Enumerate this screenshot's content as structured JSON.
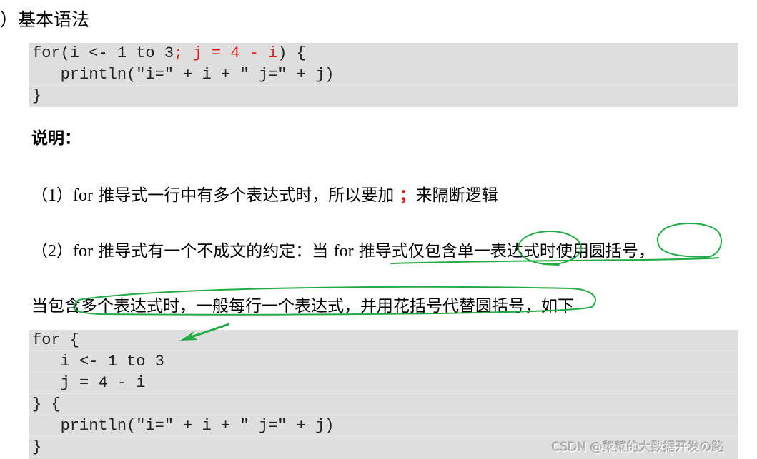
{
  "heading": "）基本语法",
  "code_block_1": {
    "lines": [
      {
        "normal": "for(i <- 1 to 3",
        "red": "; j = 4 - i",
        "tail": ") {"
      },
      {
        "text": "   println(\"i=\" + i + \" j=\" + j)"
      },
      {
        "text": "}"
      }
    ]
  },
  "explanation_label": "说明：",
  "paragraphs": {
    "p1": {
      "prefix": "（",
      "num": "1",
      "mid": "）",
      "kw": "for",
      "text": " 推导式一行中有多个表达式时，所以要加 ",
      "semicolon": "；",
      "suffix": "来隔断逻辑"
    },
    "p2": {
      "prefix": "（",
      "num": "2",
      "mid": "）",
      "kw": "for",
      "text1": " 推导式有一个不成文的约定：当 ",
      "kw2": "for",
      "text2": " 推导式仅包含单一表达式时使用圆括号，"
    },
    "p3": {
      "text": "当包含多个表达式时，一般每行一个表达式，并用花括号代替圆括号，如下"
    }
  },
  "code_block_2": {
    "lines": [
      "for {",
      "   i <- 1 to 3",
      "   j = 4 - i",
      "} {",
      "   println(\"i=\" + i + \" j=\" + j)",
      "}"
    ]
  },
  "annotation_color": "#22aa44",
  "watermark": "CSDN @菜菜的大数据开发の路"
}
